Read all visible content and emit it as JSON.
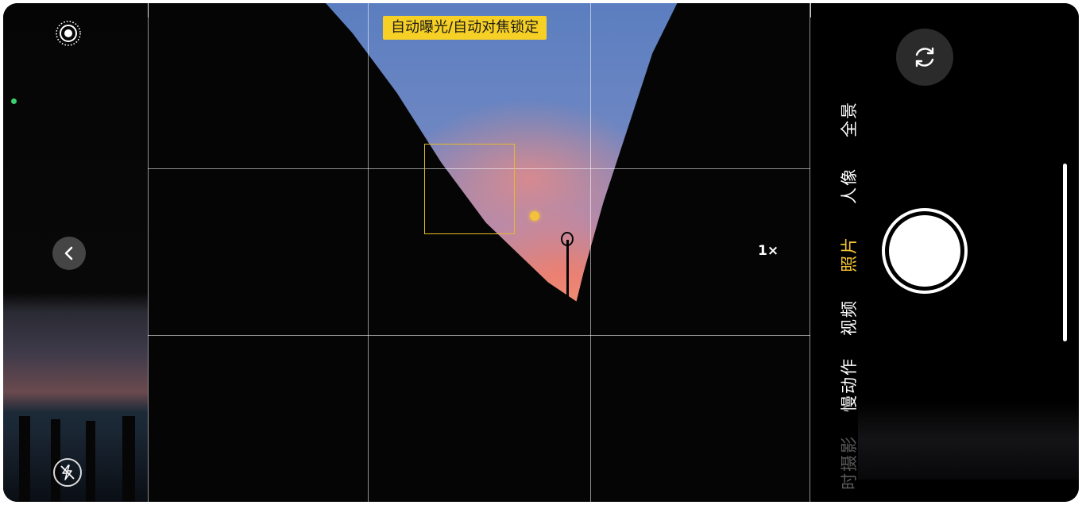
{
  "camera": {
    "lock_badge": "自动曝光/自动对焦锁定",
    "zoom_label": "1×",
    "modes": [
      {
        "label": "全景",
        "state": "normal"
      },
      {
        "label": "人像",
        "state": "normal"
      },
      {
        "label": "照片",
        "state": "active"
      },
      {
        "label": "视频",
        "state": "normal"
      },
      {
        "label": "慢动作",
        "state": "normal"
      },
      {
        "label": "时摄影",
        "state": "faded"
      }
    ],
    "icons": {
      "live_photo": "live-photo-icon",
      "back": "chevron-left-icon",
      "flash": "flash-off-icon",
      "switch_camera": "camera-switch-icon",
      "shutter": "shutter-button"
    },
    "colors": {
      "accent": "#f7c531",
      "badge_bg": "#f7d025",
      "focus_box": "#e6b92c",
      "indicator": "#3bd16f"
    }
  }
}
